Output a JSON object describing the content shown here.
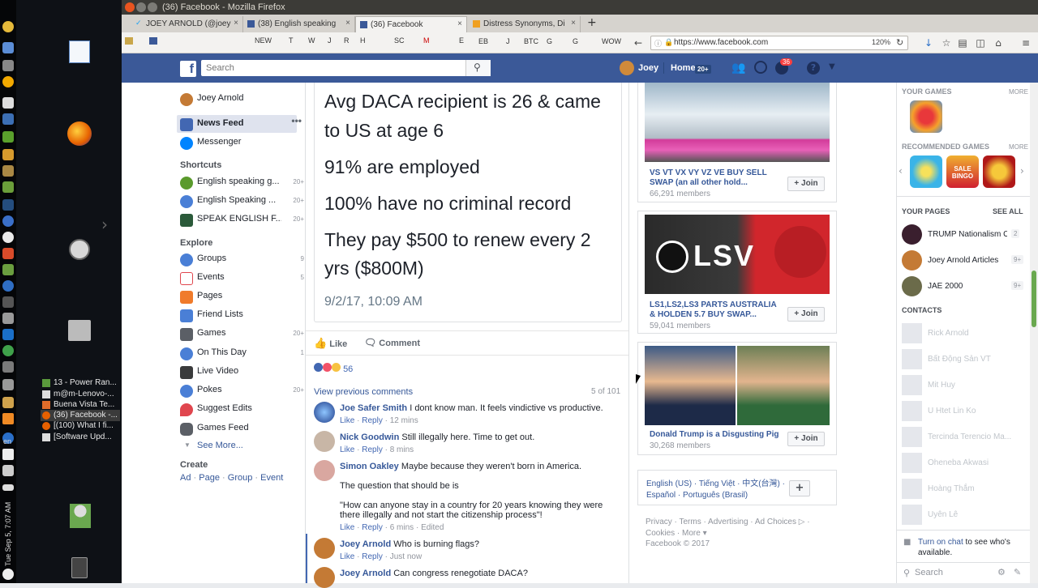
{
  "desktop": {
    "clock": "Tue Sep 5, 7:07 AM",
    "lang": "en",
    "tasks": [
      "13 - Power Ran...",
      "m@m-Lenovo-...",
      "Buena Vista Te...",
      "(36) Facebook -...",
      "[(100) What I fi...",
      "[Software Upd..."
    ]
  },
  "window": {
    "title": "(36) Facebook - Mozilla Firefox"
  },
  "tabs": [
    {
      "label": "JOEY ARNOLD (@joey",
      "close": "×"
    },
    {
      "label": "(38) English speaking",
      "close": "×"
    },
    {
      "label": "(36) Facebook",
      "close": "×"
    },
    {
      "label": "Distress Synonyms, Di",
      "close": "×"
    }
  ],
  "newtab": "+",
  "bookmarks": [
    "NEW",
    "T",
    "W",
    "J",
    "R",
    "H",
    "SC",
    "M",
    "E",
    "EB",
    "J",
    "BTC",
    "G",
    "G",
    "WOW"
  ],
  "url": "https://www.facebook.com",
  "zoom": "120%",
  "fb": {
    "search_placeholder": "Search",
    "user": "Joey",
    "home": "Home",
    "home_count": "20+",
    "notif_count": "36"
  },
  "left": {
    "profile": "Joey Arnold",
    "news_feed": "News Feed",
    "messenger": "Messenger",
    "shortcuts_title": "Shortcuts",
    "shortcuts": [
      {
        "label": "English speaking g...",
        "count": "20+"
      },
      {
        "label": "English Speaking ...",
        "count": "20+"
      },
      {
        "label": "SPEAK ENGLISH F...",
        "count": "20+"
      }
    ],
    "explore_title": "Explore",
    "explore": [
      {
        "label": "Groups",
        "count": "9"
      },
      {
        "label": "Events",
        "count": "5"
      },
      {
        "label": "Pages",
        "count": ""
      },
      {
        "label": "Friend Lists",
        "count": ""
      },
      {
        "label": "Games",
        "count": "20+"
      },
      {
        "label": "On This Day",
        "count": "1"
      },
      {
        "label": "Live Video",
        "count": ""
      },
      {
        "label": "Pokes",
        "count": "20+"
      },
      {
        "label": "Suggest Edits",
        "count": ""
      },
      {
        "label": "Games Feed",
        "count": ""
      }
    ],
    "see_more": "See More...",
    "create_title": "Create",
    "create": [
      "Ad",
      "Page",
      "Group",
      "Event"
    ]
  },
  "post": {
    "lines": [
      "Avg DACA recipient is 26 & came",
      "to US at age 6",
      "91% are employed",
      "100% have no criminal record",
      "They pay $500 to renew every 2",
      "yrs ($800M)"
    ],
    "date": "9/2/17, 10:09 AM",
    "like": "Like",
    "comment": "Comment",
    "reactions": "56",
    "view_prev": "View previous comments",
    "count": "5 of 101",
    "comments": [
      {
        "name": "Joe Safer Smith",
        "text": "I dont know man. It feels vindictive vs productive.",
        "time": "12 mins"
      },
      {
        "name": "Nick Goodwin",
        "text": "Still illegally here. Time to get out.",
        "time": "8 mins"
      },
      {
        "name": "Simon Oakley",
        "text": "Maybe because they weren't born in America.",
        "text2": "The question that should be is",
        "text3": "\"How can anyone stay in a country for 20 years knowing they were there illegally and not start the citizenship process\"!",
        "time": "6 mins",
        "edited": "Edited"
      },
      {
        "name": "Joey Arnold",
        "text": "Who is burning flags?",
        "time": "Just now"
      },
      {
        "name": "Joey Arnold",
        "text": "Can congress renegotiate DACA?",
        "time": ""
      }
    ],
    "action_like": "Like",
    "action_reply": "Reply"
  },
  "groups": [
    {
      "name": "VS VT VX VY VZ VE BUY SELL SWAP (an all other hold...",
      "members": "66,291 members",
      "join": "Join"
    },
    {
      "name": "LS1,LS2,LS3 PARTS AUSTRALIA & HOLDEN 5.7 BUY SWAP...",
      "members": "59,041 members",
      "join": "Join"
    },
    {
      "name": "Donald Trump is a Disgusting Pig",
      "members": "30,268 members",
      "join": "Join"
    }
  ],
  "lsv_text": "LSV",
  "footer": {
    "langs": "English (US) · Tiếng Việt · 中文(台灣) · Español · Português (Brasil)",
    "links": "Privacy · Terms · Advertising · Ad Choices ▷ · Cookies · More ▾",
    "copy": "Facebook © 2017"
  },
  "rail": {
    "your_games": "YOUR GAMES",
    "more1": "MORE",
    "rec_games": "RECOMMENDED GAMES",
    "more2": "MORE",
    "bingo": "SALE BINGO",
    "your_pages": "YOUR PAGES",
    "see_all": "SEE ALL",
    "pages": [
      {
        "name": "TRUMP Nationalism O...",
        "count": "2"
      },
      {
        "name": "Joey Arnold Articles",
        "count": "9+"
      },
      {
        "name": "JAE 2000",
        "count": "9+"
      }
    ],
    "contacts_title": "CONTACTS",
    "contacts": [
      "Rick Arnold",
      "Bất Động Sản VT",
      "Mit Huy",
      "U Htet Lin Ko",
      "Tercinda Terencio Ma...",
      "Oheneba Akwasi",
      "Hoàng Thắm",
      "Uyên Lê"
    ],
    "chat_link": "Turn on chat",
    "chat_text": " to see who's available.",
    "chat_search": "Search"
  }
}
